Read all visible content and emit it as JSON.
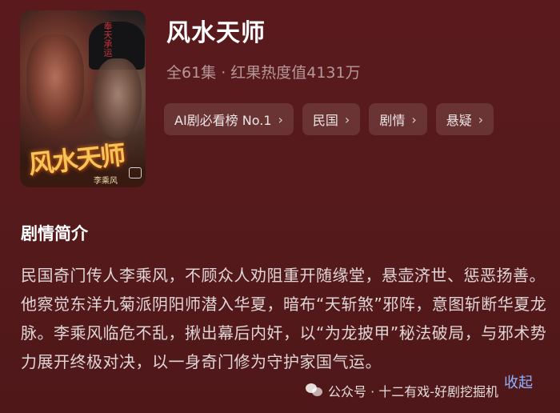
{
  "poster": {
    "logo_text": "风水天师",
    "author": "李乘风",
    "seal_text": "奉天承运"
  },
  "drama": {
    "title": "风水天师",
    "episodes": "全61集",
    "separator": "·",
    "heat": "红果热度值4131万"
  },
  "tags": [
    {
      "label": "AI剧必看榜 No.1"
    },
    {
      "label": "民国"
    },
    {
      "label": "剧情"
    },
    {
      "label": "悬疑"
    }
  ],
  "chevron": "›",
  "synopsis_section": {
    "title": "剧情简介",
    "text": "民国奇门传人李乘风，不顾众人劝阻重开随缘堂，悬壶济世、惩恶扬善。他察觉东洋九菊派阴阳师潜入华夏，暗布“天斩煞”邪阵，意图斩断华夏龙脉。李乘风临危不乱，揪出幕后内奸，以“为龙披甲”秘法破局，与邪术势力展开终极对决，以一身奇门修为守护家国气运。",
    "collapse_label": "收起"
  },
  "watermark": {
    "text": "公众号 · 十二有戏-好剧挖掘机"
  },
  "colors": {
    "background": "#561a1c",
    "link": "#8fb2ff",
    "logo_gold": "#f4c457"
  }
}
